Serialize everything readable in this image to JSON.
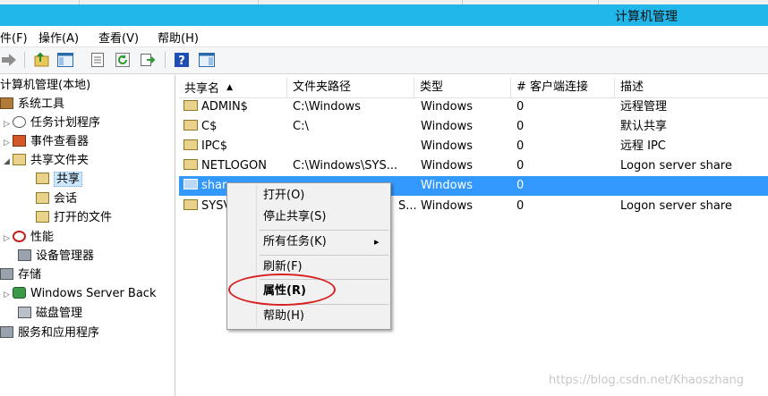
{
  "window": {
    "title": "计算机管理"
  },
  "menu": [
    "件(F)",
    "操作(A)",
    "查看(V)",
    "帮助(H)"
  ],
  "toolbar": {
    "buttons": [
      "back-icon",
      "forward-icon",
      "up-folder-icon",
      "show-hide-tree-icon",
      "properties-icon",
      "refresh-icon",
      "export-icon",
      "help-icon",
      "show-action-pane-icon"
    ]
  },
  "tree": {
    "root": "计算机管理(本地)",
    "system_tools": "系统工具",
    "task_scheduler": "任务计划程序",
    "event_viewer": "事件查看器",
    "shared_folders": "共享文件夹",
    "shares": "共享",
    "sessions": "会话",
    "open_files": "打开的文件",
    "performance": "性能",
    "device_manager": "设备管理器",
    "storage": "存储",
    "windows_server_backup": "Windows Server Back",
    "disk_management": "磁盘管理",
    "services_apps": "服务和应用程序"
  },
  "list": {
    "headers": [
      "共享名",
      "文件夹路径",
      "类型",
      "# 客户端连接",
      "描述"
    ],
    "sort_indicator": "▲",
    "rows": [
      {
        "name": "ADMIN$",
        "path": "C:\\Windows",
        "type": "Windows",
        "clients": "0",
        "desc": "远程管理"
      },
      {
        "name": "C$",
        "path": "C:\\",
        "type": "Windows",
        "clients": "0",
        "desc": "默认共享"
      },
      {
        "name": "IPC$",
        "path": "",
        "type": "Windows",
        "clients": "0",
        "desc": "远程 IPC"
      },
      {
        "name": "NETLOGON",
        "path": "C:\\Windows\\SYS...",
        "type": "Windows",
        "clients": "0",
        "desc": "Logon server share"
      },
      {
        "name": "shar",
        "path": "",
        "type": "Windows",
        "clients": "0",
        "desc": ""
      },
      {
        "name": "SYSV",
        "path": "S...",
        "type": "Windows",
        "clients": "0",
        "desc": "Logon server share"
      }
    ]
  },
  "context_menu": {
    "open": "打开(O)",
    "stop_sharing": "停止共享(S)",
    "all_tasks": "所有任务(K)",
    "all_tasks_arrow": "▸",
    "refresh": "刷新(F)",
    "properties": "属性(R)",
    "help": "帮助(H)"
  },
  "watermark": "https://blog.csdn.net/Khaoszhang",
  "colors": {
    "titlebar": "#22b7ea",
    "selection": "#3399ff",
    "annotation": "#d82020"
  }
}
